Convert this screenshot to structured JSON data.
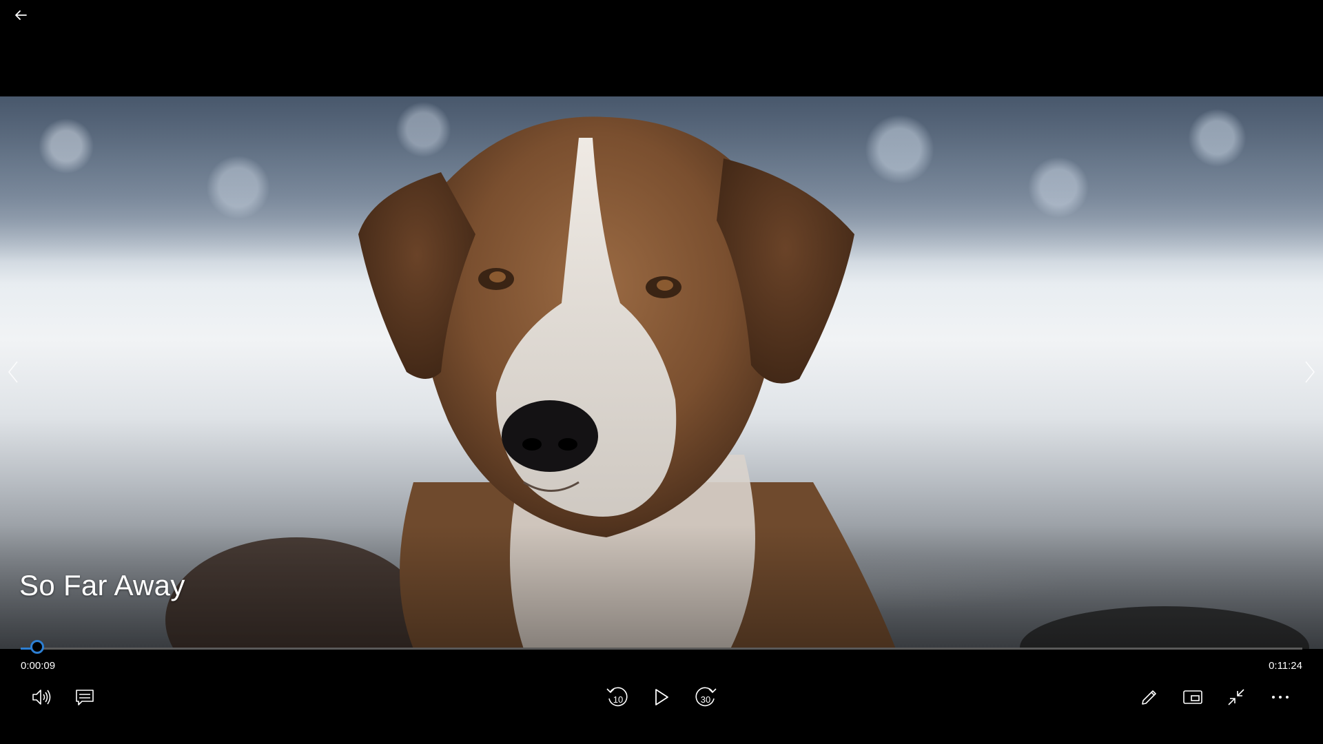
{
  "player": {
    "title": "So Far Away",
    "elapsed": "0:00:09",
    "total": "0:11:24",
    "progress_fraction": 0.013,
    "accent_color": "#2d7fd3"
  },
  "controls": {
    "back": "arrow-left-icon",
    "volume": "volume-icon",
    "subtitles": "subtitles-icon",
    "skip_back": "skip-back-10-icon",
    "skip_back_label": "10",
    "play": "play-icon",
    "skip_forward": "skip-forward-30-icon",
    "skip_forward_label": "30",
    "edit": "pencil-icon",
    "mini_view": "mini-view-icon",
    "exit_fullscreen": "exit-fullscreen-icon",
    "more": "more-icon",
    "previous": "chevron-left-icon",
    "next": "chevron-right-icon"
  }
}
